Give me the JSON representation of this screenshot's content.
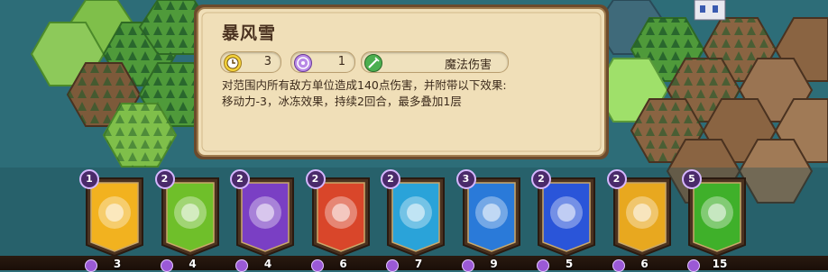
{
  "tooltip": {
    "title": "暴风雪",
    "stats": [
      {
        "icon": "clock-icon",
        "value": "3"
      },
      {
        "icon": "target-icon",
        "value": "1"
      },
      {
        "icon": "magic-sword-icon",
        "value": "魔法伤害"
      }
    ],
    "description": "对范围内所有敌方单位造成140点伤害，并附带以下效果:\n移动力-3，冰冻效果，持续2回合，最多叠加1层"
  },
  "cards": [
    {
      "cost": "1",
      "count": "3",
      "icon": "sunburst-icon",
      "color": "#f2b21f"
    },
    {
      "cost": "2",
      "count": "4",
      "icon": "green-burst-icon",
      "color": "#6fbf2a"
    },
    {
      "cost": "2",
      "count": "4",
      "icon": "gear-tools-icon",
      "color": "#7a3fc4"
    },
    {
      "cost": "2",
      "count": "6",
      "icon": "fire-figure-icon",
      "color": "#d9462a"
    },
    {
      "cost": "2",
      "count": "7",
      "icon": "tornado-icon",
      "color": "#2aa3d9"
    },
    {
      "cost": "3",
      "count": "9",
      "icon": "ice-rain-icon",
      "color": "#2a7ad9"
    },
    {
      "cost": "2",
      "count": "5",
      "icon": "blue-slash-icon",
      "color": "#2a55d9"
    },
    {
      "cost": "2",
      "count": "6",
      "icon": "holy-heal-icon",
      "color": "#e8a81f"
    },
    {
      "cost": "5",
      "count": "15",
      "icon": "green-shield-icon",
      "color": "#3fb02a"
    }
  ]
}
